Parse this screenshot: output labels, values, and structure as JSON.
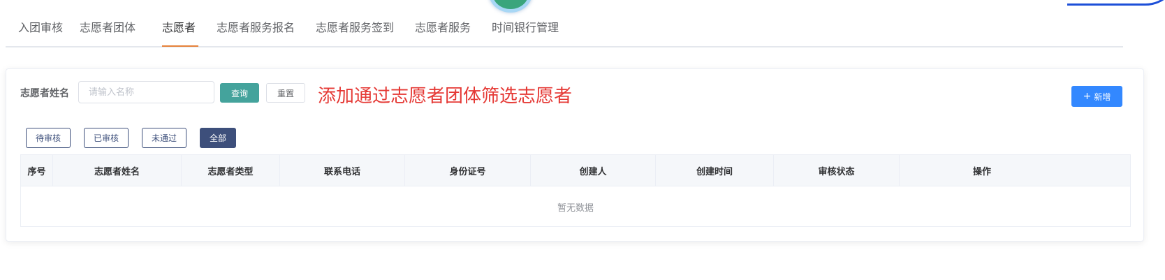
{
  "tabs": [
    {
      "label": "入团审核",
      "active": false
    },
    {
      "label": "志愿者团体",
      "active": false
    },
    {
      "label": "志愿者",
      "active": true
    },
    {
      "label": "志愿者服务报名",
      "active": false
    },
    {
      "label": "志愿者服务签到",
      "active": false
    },
    {
      "label": "志愿者服务",
      "active": false
    },
    {
      "label": "时间银行管理",
      "active": false
    }
  ],
  "filter": {
    "name_label": "志愿者姓名",
    "name_placeholder": "请输入名称",
    "name_value": "",
    "query_label": "查询",
    "reset_label": "重置"
  },
  "annotation": "添加通过志愿者团体筛选志愿者",
  "add_button": {
    "icon": "plus-icon",
    "label": "新增"
  },
  "status_filters": [
    {
      "label": "待审核",
      "active": false
    },
    {
      "label": "已审核",
      "active": false
    },
    {
      "label": "未通过",
      "active": false
    },
    {
      "label": "全部",
      "active": true
    }
  ],
  "table": {
    "columns": [
      "序号",
      "志愿者姓名",
      "志愿者类型",
      "联系电话",
      "身份证号",
      "创建人",
      "创建时间",
      "审核状态",
      "操作"
    ],
    "rows": [],
    "empty_text": "暂无数据"
  },
  "colors": {
    "accent_query": "#44a39c",
    "accent_add": "#3388ff",
    "status_active": "#3d4f7b",
    "tab_underline": "#e6813a",
    "annotation": "#e53935"
  }
}
